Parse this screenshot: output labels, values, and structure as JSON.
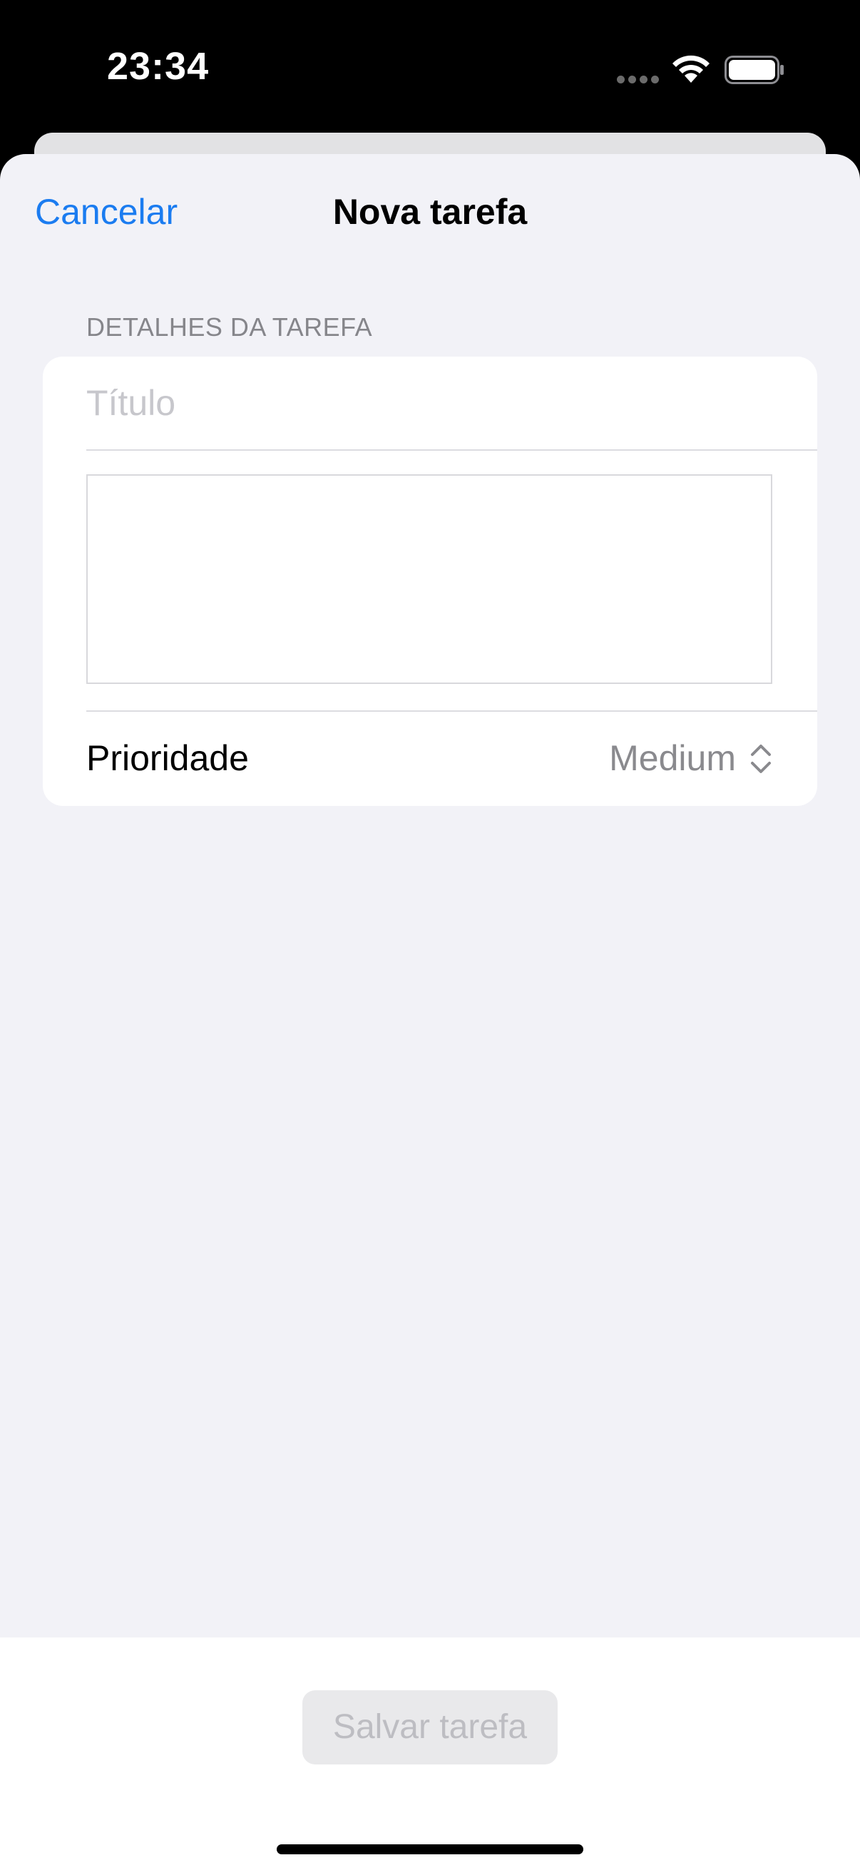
{
  "status_bar": {
    "time": "23:34"
  },
  "nav": {
    "cancel_label": "Cancelar",
    "title": "Nova tarefa"
  },
  "form": {
    "section_header": "DETALHES DA TAREFA",
    "title_value": "",
    "title_placeholder": "Título",
    "description_value": "",
    "priority_label": "Prioridade",
    "priority_value": "Medium"
  },
  "footer": {
    "save_label": "Salvar tarefa"
  },
  "colors": {
    "accent": "#1b7cf0",
    "background": "#f2f2f7",
    "card": "#ffffff",
    "secondary_text": "#8a8a8e",
    "disabled_button_bg": "#e9e9eb",
    "disabled_button_text": "#bdbdc2"
  },
  "icons": {
    "wifi": "wifi-icon",
    "battery": "battery-icon",
    "signal": "signal-dots-icon",
    "priority_picker": "chevron-updown-icon"
  }
}
